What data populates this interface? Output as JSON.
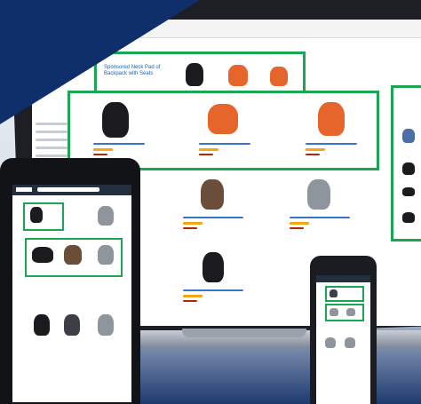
{
  "colors": {
    "highlight_green": "#1aa653",
    "navy_corner": "#0f2f6b",
    "link_blue": "#1a5fb4",
    "star_orange": "#f3a712"
  },
  "laptop": {
    "topbar_text": "",
    "ad_strip": {
      "title": "Sponsored Neck Pad of Backpack with Seats",
      "products": [
        "black backpack",
        "orange bag",
        "orange/gray bag"
      ]
    },
    "recommended_row": {
      "products": [
        "black backpack",
        "orange messenger bag",
        "orange sling bag"
      ]
    },
    "grid_products": [
      "brown backpack",
      "gray backpack",
      "black backpack"
    ],
    "side_column_products": [
      "blue backpack",
      "black bag",
      "black bag",
      "black bag"
    ]
  },
  "tablet": {
    "header_search_placeholder": "",
    "ad_products": [
      "black backpack",
      "gray backpack"
    ],
    "highlight_products": [
      "black bag",
      "brown bag",
      "gray bag"
    ],
    "grid_products": [
      "black backpack",
      "dark backpack",
      "gray backpack"
    ]
  },
  "phone": {
    "highlight_products": [
      "dark bag",
      "gray bag",
      "gray bag"
    ]
  }
}
